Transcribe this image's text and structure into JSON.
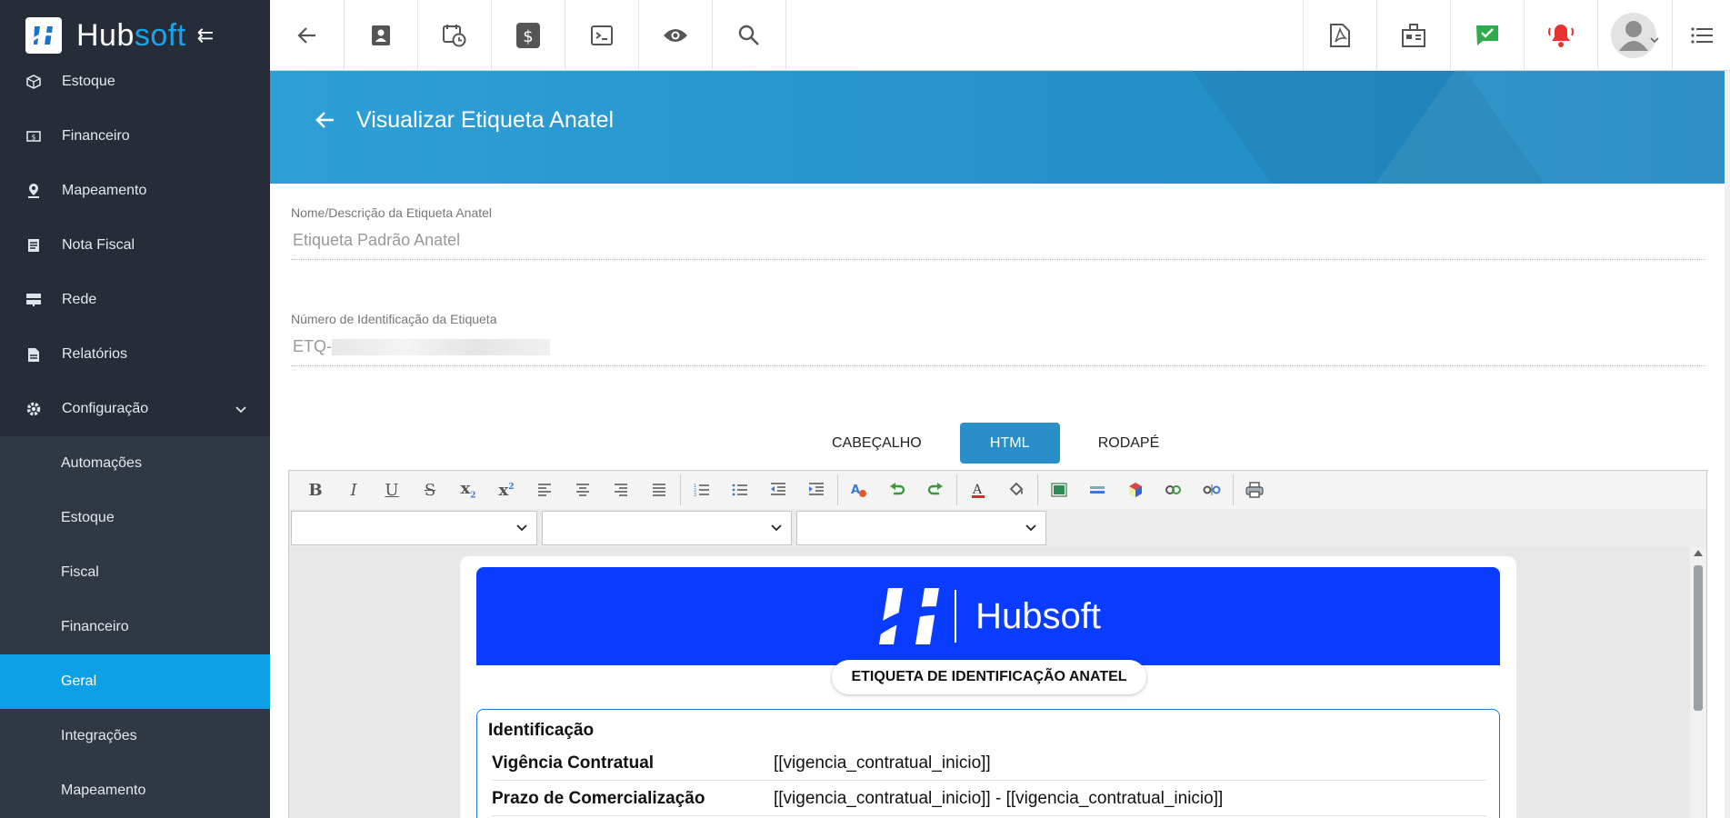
{
  "brand": {
    "name_hub": "Hub",
    "name_soft": "soft"
  },
  "sidebar": {
    "items": [
      {
        "label": "Estoque",
        "icon": "box-icon"
      },
      {
        "label": "Financeiro",
        "icon": "money-icon"
      },
      {
        "label": "Mapeamento",
        "icon": "map-pin-icon"
      },
      {
        "label": "Nota Fiscal",
        "icon": "receipt-icon"
      },
      {
        "label": "Rede",
        "icon": "server-icon"
      },
      {
        "label": "Relatórios",
        "icon": "report-icon"
      },
      {
        "label": "Configuração",
        "icon": "gear-icon"
      }
    ],
    "sub_items": [
      {
        "label": "Automações"
      },
      {
        "label": "Estoque"
      },
      {
        "label": "Fiscal"
      },
      {
        "label": "Financeiro"
      },
      {
        "label": "Geral"
      },
      {
        "label": "Integrações"
      },
      {
        "label": "Mapeamento"
      }
    ],
    "active_sub": "Geral"
  },
  "topbar": {
    "left_icons": [
      "back-arrow-icon",
      "contact-card-icon",
      "calendar-clock-icon",
      "dollar-icon",
      "terminal-icon",
      "eye-icon",
      "search-icon"
    ],
    "right_icons": [
      "pdf-icon",
      "building-icon",
      "chat-check-icon",
      "bell-icon",
      "user-avatar-icon",
      "list-menu-icon"
    ]
  },
  "page": {
    "title": "Visualizar Etiqueta Anatel"
  },
  "form": {
    "name_label": "Nome/Descrição da Etiqueta Anatel",
    "name_value": "Etiqueta Padrão Anatel",
    "id_label": "Número de Identificação da Etiqueta",
    "id_value_prefix": "ETQ-"
  },
  "tabs": [
    "CABEÇALHO",
    "HTML",
    "RODAPÉ"
  ],
  "active_tab": "HTML",
  "document": {
    "brand": "Hubsoft",
    "pill": "ETIQUETA DE IDENTIFICAÇÃO ANATEL",
    "section_title": "Identificação",
    "rows": [
      {
        "key": "Vigência Contratual",
        "value": "[[vigencia_contratual_inicio]]"
      },
      {
        "key": "Prazo de Comercialização",
        "value": "[[vigencia_contratual_inicio]] - [[vigencia_contratual_inicio]]"
      }
    ]
  },
  "colors": {
    "sidebar": "#262d38",
    "active": "#0ea0e6",
    "banner": "#2591c9",
    "doc_header": "#0a3cff"
  }
}
